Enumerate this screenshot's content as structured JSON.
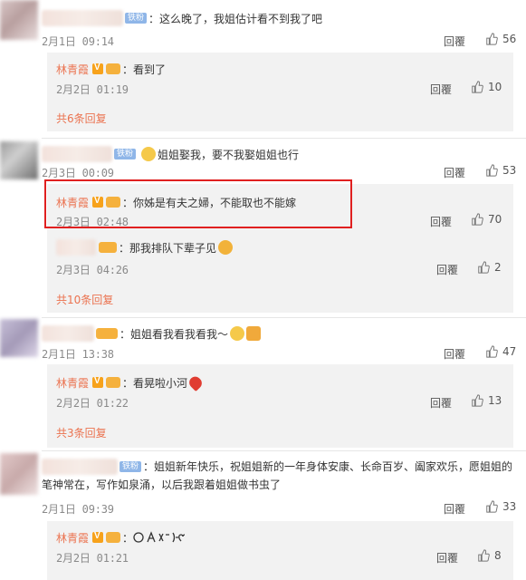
{
  "like_icon": "thumbs-up-icon",
  "verified_badge": "verified-v-icon",
  "level_badge": "fan-level-icon",
  "colors": {
    "reply_name": "#eb7350",
    "highlight": "#e02020",
    "more_link": "#eb7350"
  },
  "comments": [
    {
      "fan_label": "铁粉",
      "text": "：这么晚了，我姐估计看不到我了吧",
      "date": "2月1日 09:14",
      "reply_label": "回覆",
      "likes": "56",
      "replies": [
        {
          "name": "林青霞",
          "text": "：看到了",
          "date": "2月2日 01:19",
          "reply_label": "回覆",
          "likes": "10"
        }
      ],
      "more": "共6条回复"
    },
    {
      "fan_label": "铁粉",
      "text": "姐姐娶我，要不我娶姐姐也行",
      "date": "2月3日 00:09",
      "reply_label": "回覆",
      "likes": "53",
      "replies": [
        {
          "name": "林青霞",
          "text": "：你姊是有夫之婦，不能取也不能嫁",
          "date": "2月3日 02:48",
          "reply_label": "回覆",
          "likes": "70"
        },
        {
          "name": "",
          "text": "：那我排队下辈子见",
          "date": "2月3日 04:26",
          "reply_label": "回覆",
          "likes": "2"
        }
      ],
      "more": "共10条回复"
    },
    {
      "fan_label": "",
      "text": "：姐姐看我看我看我～",
      "date": "2月1日 13:38",
      "reply_label": "回覆",
      "likes": "47",
      "replies": [
        {
          "name": "林青霞",
          "text": "：看晃啦小河",
          "date": "2月2日 01:22",
          "reply_label": "回覆",
          "likes": "13"
        }
      ],
      "more": "共3条回复"
    },
    {
      "fan_label": "铁粉",
      "text_line1": "：姐姐新年快乐，祝姐姐新的一年身体安康、长命百岁、阖家欢乐，愿姐姐的",
      "text_line2": "笔神常在，写作如泉涌，以后我跟着姐姐做书虫了",
      "date": "2月1日 09:39",
      "reply_label": "回覆",
      "likes": "33",
      "replies": [
        {
          "name": "林青霞",
          "text": "：",
          "date": "2月2日 01:21",
          "reply_label": "回覆",
          "likes": "8"
        }
      ]
    }
  ]
}
